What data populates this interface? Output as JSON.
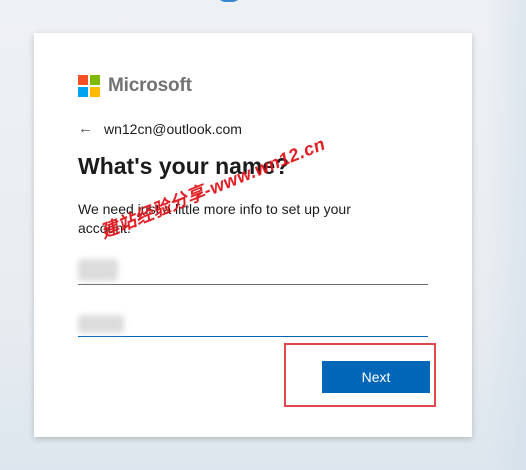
{
  "brand": {
    "name": "Microsoft",
    "logo_colors": [
      "#f25022",
      "#7fba00",
      "#00a4ef",
      "#ffb900"
    ]
  },
  "identity": {
    "back_icon": "←",
    "email": "wn12cn@outlook.com"
  },
  "heading": "What's your name?",
  "description": "We need just a little more info to set up your account.",
  "form": {
    "first_name_value": "",
    "last_name_value": ""
  },
  "buttons": {
    "next_label": "Next"
  },
  "watermark": {
    "text": "建站经验分享-www.wn12.cn"
  },
  "colors": {
    "primary": "#0067b8",
    "annotation_red": "#e0474c"
  }
}
